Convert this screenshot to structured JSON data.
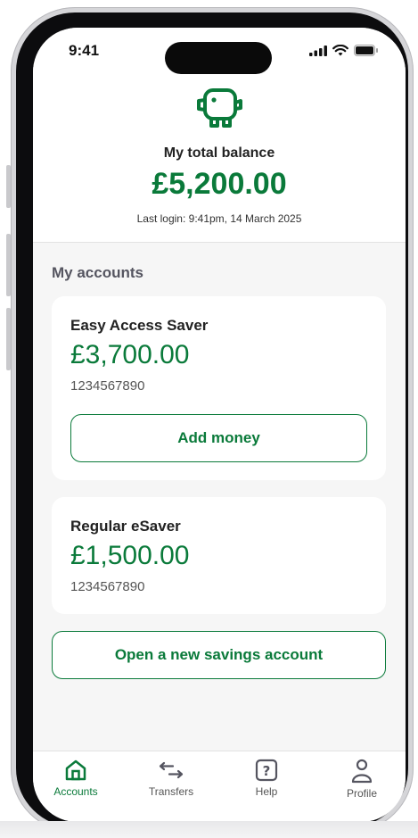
{
  "status_bar": {
    "time": "9:41"
  },
  "header": {
    "icon": "piggy-bank-icon",
    "balance_label": "My total balance",
    "balance_amount": "£5,200.00",
    "last_login": "Last login: 9:41pm, 14 March 2025"
  },
  "accounts": {
    "section_title": "My accounts",
    "items": [
      {
        "name": "Easy Access Saver",
        "amount": "£3,700.00",
        "number": "1234567890",
        "action_label": "Add money"
      },
      {
        "name": "Regular eSaver",
        "amount": "£1,500.00",
        "number": "1234567890"
      }
    ],
    "open_account_label": "Open a new savings account"
  },
  "tabbar": {
    "items": [
      {
        "label": "Accounts",
        "icon": "home-icon",
        "active": true
      },
      {
        "label": "Transfers",
        "icon": "transfer-arrows-icon",
        "active": false
      },
      {
        "label": "Help",
        "icon": "help-icon",
        "active": false
      },
      {
        "label": "Profile",
        "icon": "profile-icon",
        "active": false
      }
    ]
  },
  "colors": {
    "brand_green": "#0a7a3a",
    "background": "#f6f6f6"
  }
}
